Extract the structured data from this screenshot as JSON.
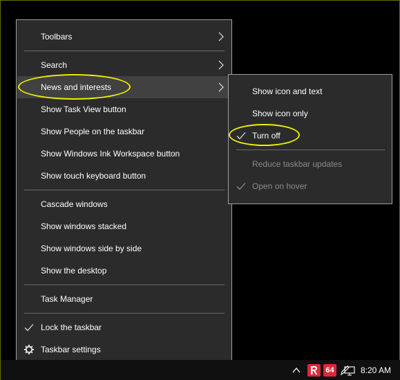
{
  "menu": {
    "items": [
      {
        "label": "Toolbars",
        "submenu": true
      },
      {
        "label": "Search",
        "submenu": true
      },
      {
        "label": "News and interests",
        "submenu": true,
        "highlighted": true
      },
      {
        "label": "Show Task View button"
      },
      {
        "label": "Show People on the taskbar"
      },
      {
        "label": "Show Windows Ink Workspace button"
      },
      {
        "label": "Show touch keyboard button"
      },
      {
        "label": "Cascade windows"
      },
      {
        "label": "Show windows stacked"
      },
      {
        "label": "Show windows side by side"
      },
      {
        "label": "Show the desktop"
      },
      {
        "label": "Task Manager"
      },
      {
        "label": "Lock the taskbar",
        "checked": true
      },
      {
        "label": "Taskbar settings",
        "icon": "gear-icon"
      }
    ]
  },
  "submenu": {
    "items": [
      {
        "label": "Show icon and text"
      },
      {
        "label": "Show icon only"
      },
      {
        "label": "Turn off",
        "checked": true
      },
      {
        "label": "Reduce taskbar updates",
        "disabled": true
      },
      {
        "label": "Open on hover",
        "disabled": true,
        "checked": true
      }
    ]
  },
  "taskbar": {
    "clock": "8:20 AM",
    "badge_64": "64",
    "icons": [
      "chevron-up-icon",
      "red-app-icon",
      "badge-64-icon",
      "pen-icon",
      "network-icon"
    ]
  },
  "colors": {
    "menu_bg": "#2b2b2b",
    "hover_bg": "#414141",
    "annotation": "#f0f000",
    "disabled_text": "#8a8a8a"
  }
}
